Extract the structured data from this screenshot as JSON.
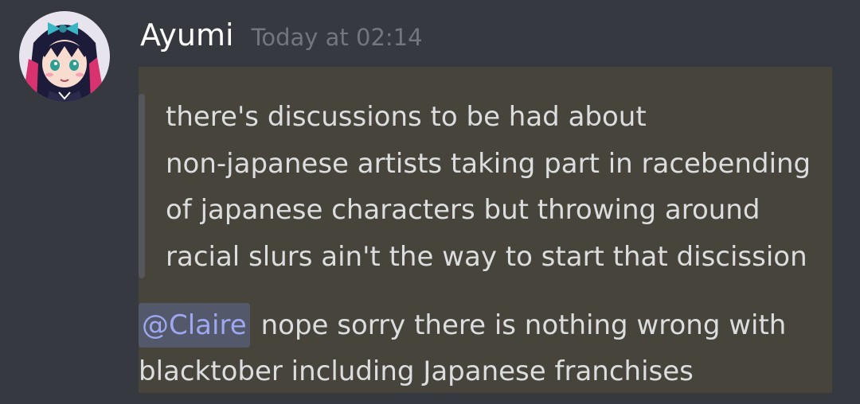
{
  "message": {
    "author": {
      "name": "Ayumi",
      "avatar_icon": "anime-girl-avatar-icon"
    },
    "timestamp": "Today at 02:14",
    "quote_lines": [
      "there's discussions to be had about",
      "non-japanese artists taking part in racebending",
      "of japanese characters but throwing around",
      "racial slurs ain't the way to start that discission"
    ],
    "reply": {
      "mention": "@Claire",
      "line1_text": "nope sorry there is nothing wrong with",
      "line2_text": "blacktober including Japanese franchises"
    }
  },
  "colors": {
    "background": "#36393f",
    "highlight": "#47443b",
    "text": "#dcddde",
    "timestamp": "#72767d",
    "mention": "#9ea8f0",
    "quote_bar": "#55575b"
  }
}
